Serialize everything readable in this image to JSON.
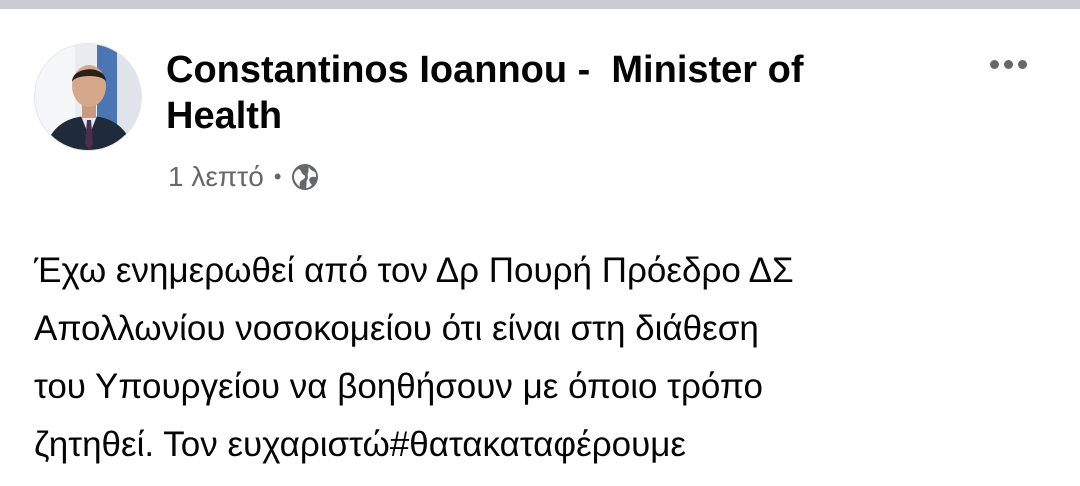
{
  "post": {
    "author": "Constantinos Ioannou -  Minister of Health",
    "timestamp": "1 λεπτό",
    "separator": "•",
    "privacy_icon": "globe-icon",
    "more_icon": "more-options-icon",
    "text": "Έχω ενημερωθεί από τον Δρ Πουρή Πρόεδρο ΔΣ\nΑπολλωνίου νοσοκομείου ότι είναι στη διάθεση\nτου Υπουργείου να βοηθήσουν με όποιο τρόπο\nζητηθεί. Τον ευχαριστώ#θατακαταφέρουμε"
  },
  "colors": {
    "text": "#050505",
    "secondary": "#65676b",
    "divider": "#c9ccd1"
  }
}
